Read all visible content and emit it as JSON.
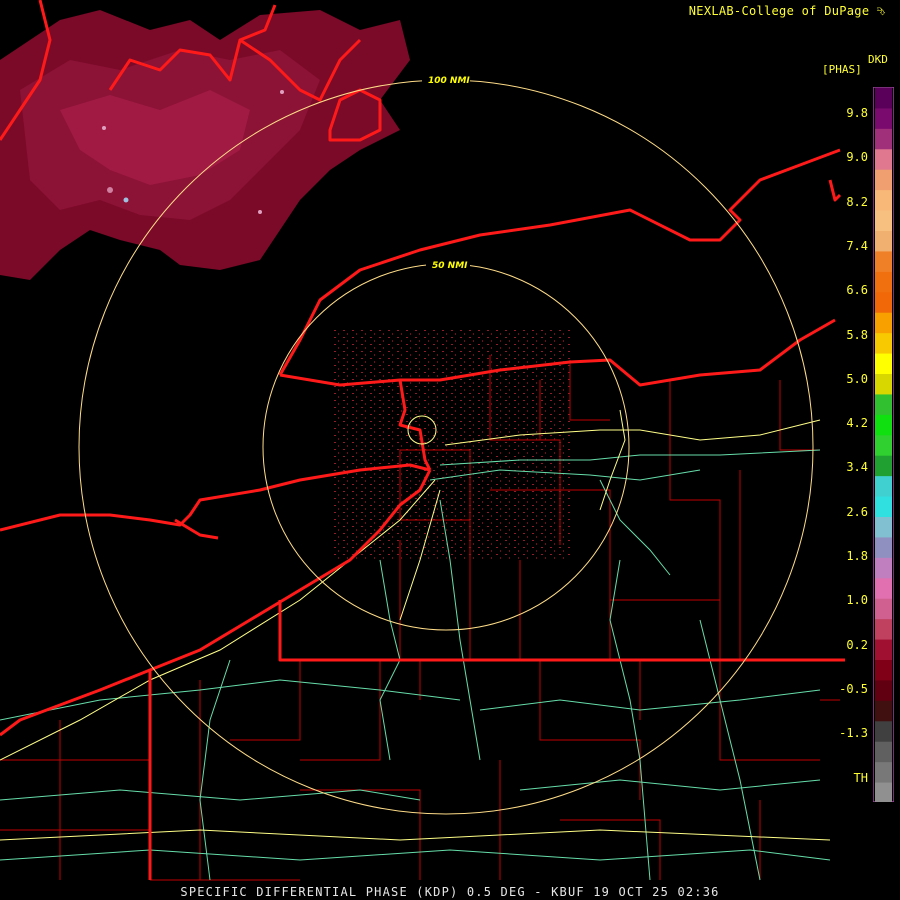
{
  "credit": "NEXLAB-College of DuPage",
  "footer": "SPECIFIC DIFFERENTIAL PHASE (KDP) 0.5 DEG - KBUF 19 OCT 25 02:36",
  "legend": {
    "product": "DKD",
    "unit": "[PHAS]",
    "ticks": [
      "9.8",
      "9.0",
      "8.2",
      "7.4",
      "6.6",
      "5.8",
      "5.0",
      "4.2",
      "3.4",
      "2.6",
      "1.8",
      "1.0",
      "0.2",
      "-0.5",
      "-1.3",
      "TH"
    ],
    "colors": [
      "#5a005a",
      "#7a0a6e",
      "#a0307a",
      "#e07890",
      "#f0a070",
      "#f8b878",
      "#f8c080",
      "#f0b070",
      "#f08028",
      "#f07010",
      "#f06808",
      "#f8a000",
      "#f8c800",
      "#ffff00",
      "#d8d800",
      "#30c030",
      "#10e010",
      "#30d030",
      "#20a030",
      "#40d0d0",
      "#30e0e0",
      "#80c0d0",
      "#9090c0",
      "#c080c0",
      "#e070b0",
      "#d06090",
      "#c04060",
      "#a01030",
      "#800018",
      "#600010",
      "#401010",
      "#404040",
      "#606060",
      "#787878",
      "#909090"
    ]
  },
  "rings": [
    {
      "label": "100 NMI"
    },
    {
      "label": "50 NMI"
    }
  ],
  "icons": {
    "credit_logo": "cod-logo-icon",
    "radar_site": "radar-site-icon"
  },
  "colors": {
    "state_border": "#ff1a1a",
    "county_line": "#cc0000",
    "interstate": "#ffff88",
    "highway": "#66ddaa",
    "range_ring": "#ffdd88",
    "echo": "#8a0a2a"
  }
}
